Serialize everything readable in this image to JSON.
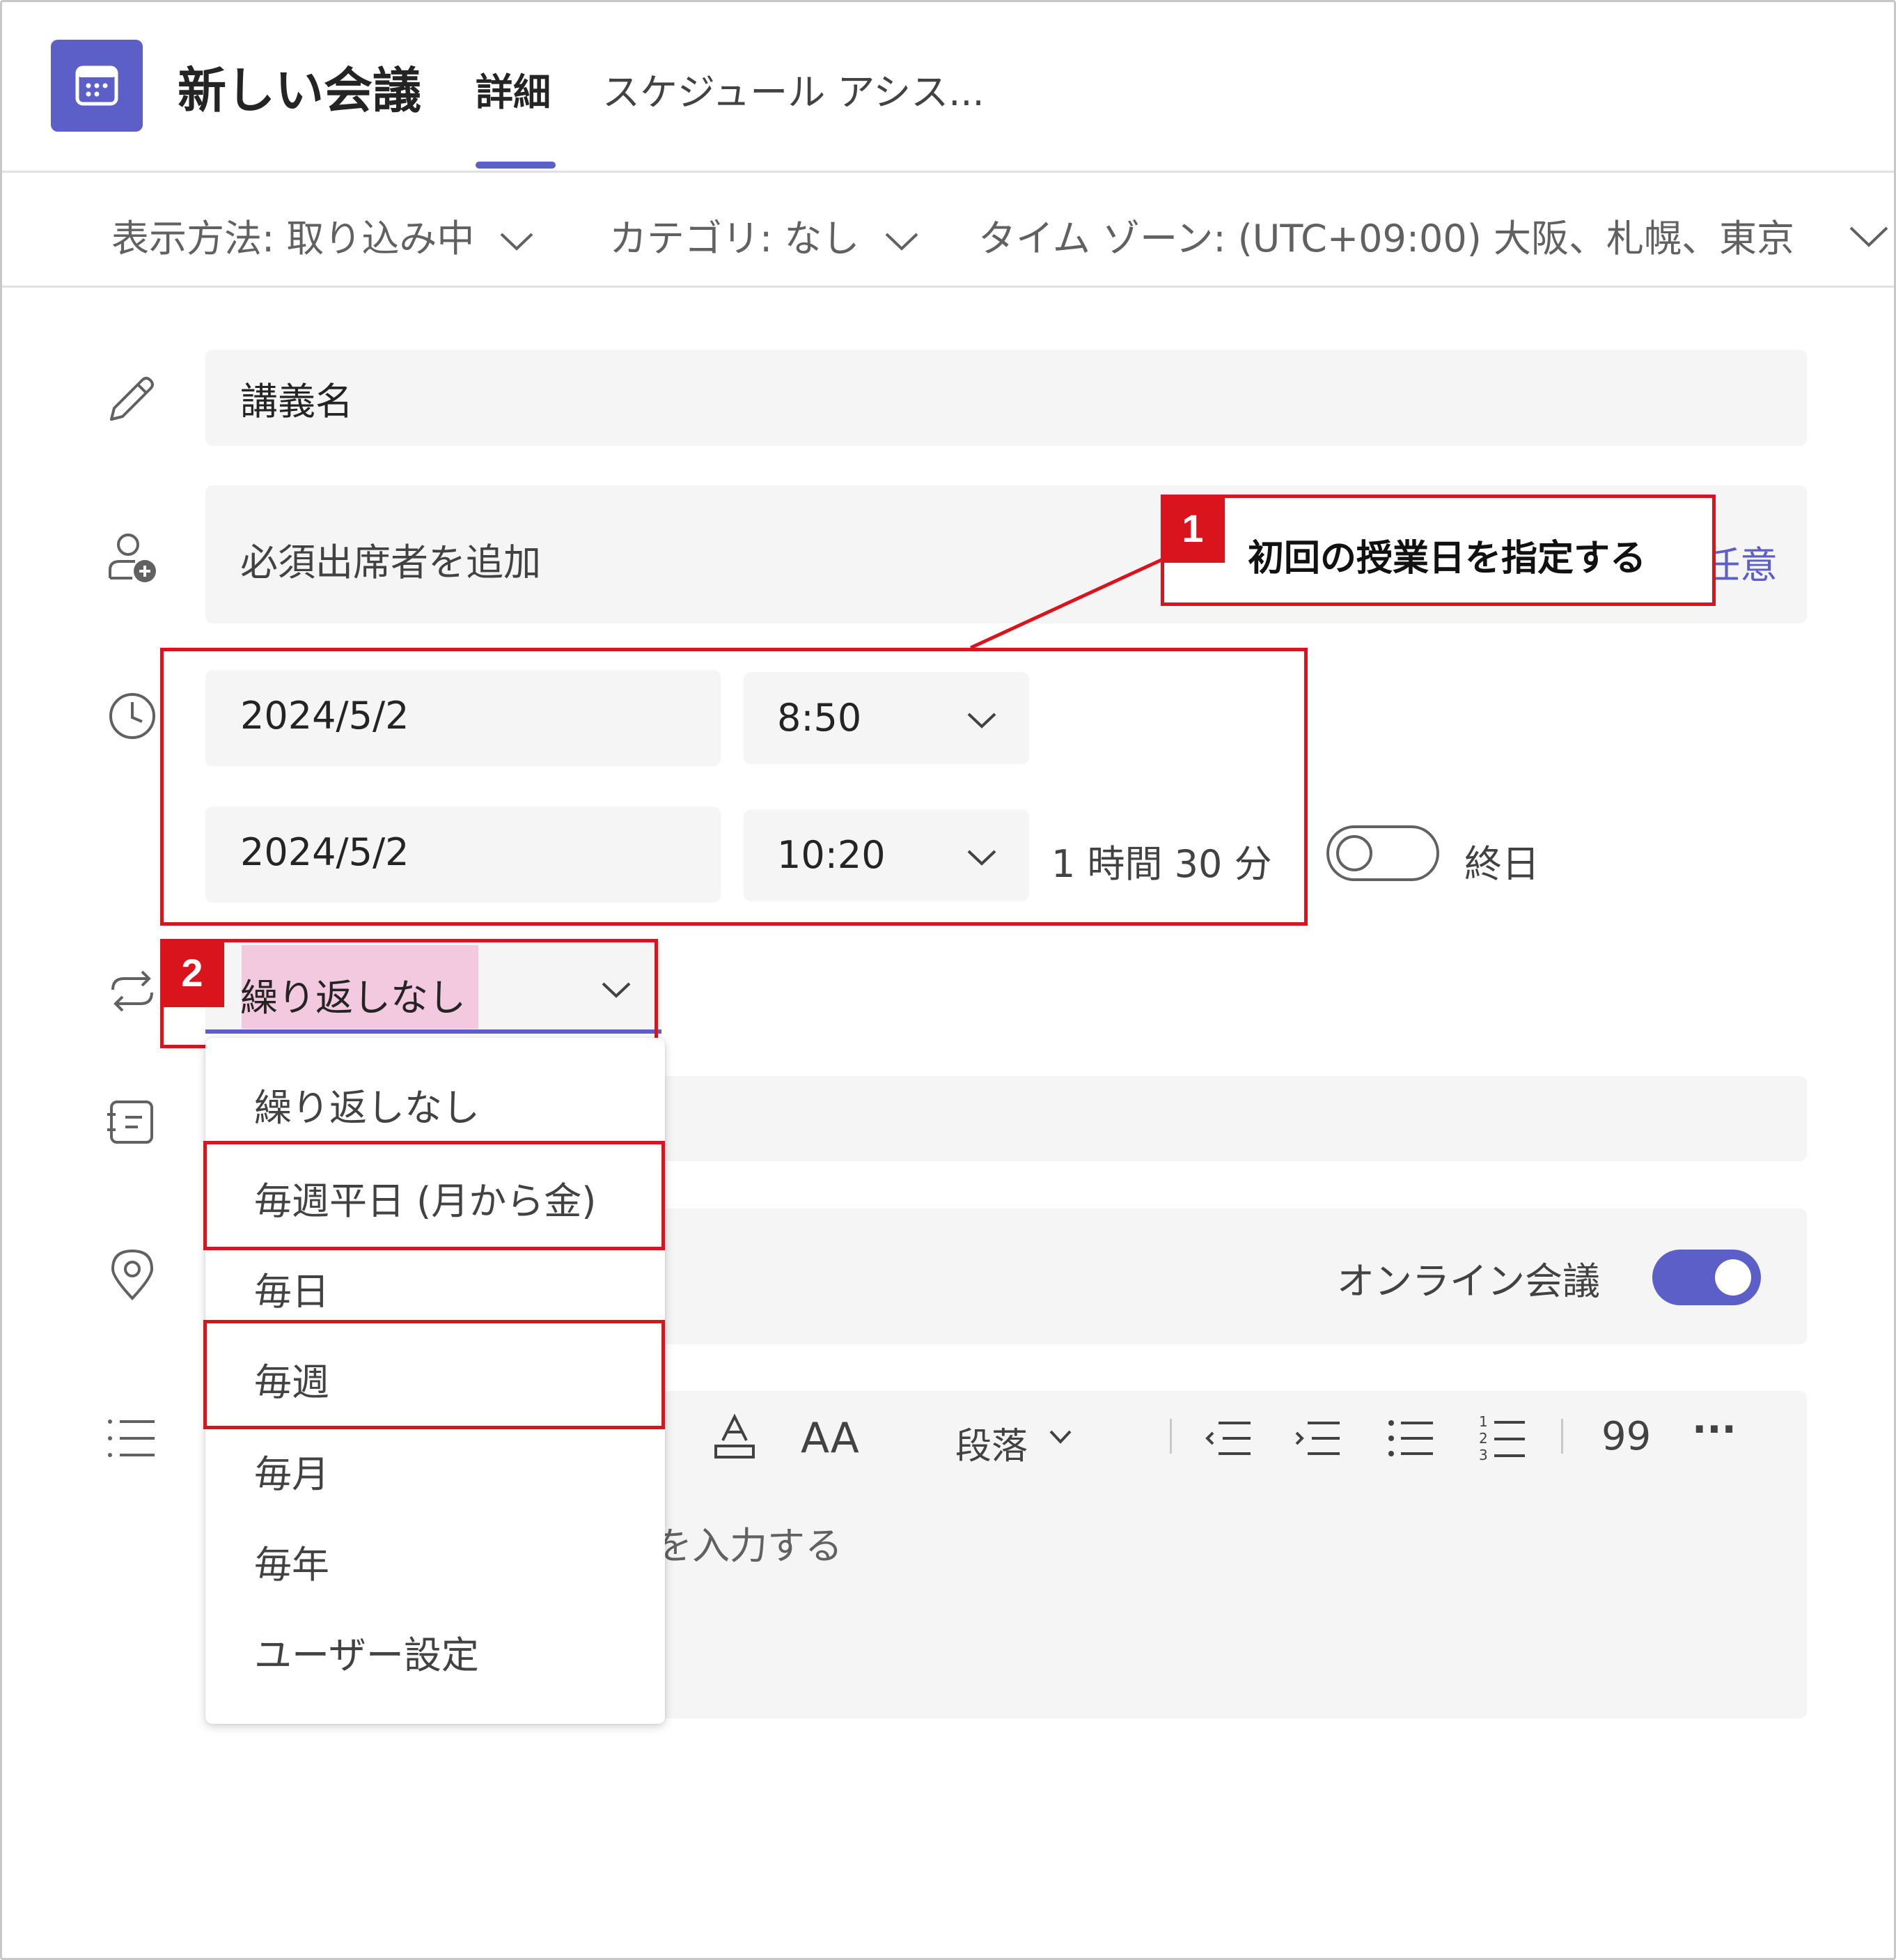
{
  "header": {
    "title": "新しい会議",
    "tabs": [
      {
        "label": "詳細",
        "active": true
      },
      {
        "label": "スケジュール アシス..."
      }
    ]
  },
  "options_bar": {
    "show_as": "表示方法: 取り込み中",
    "category": "カテゴリ: なし",
    "timezone": "タイム ゾーン: (UTC+09:00) 大阪、札幌、東京"
  },
  "form": {
    "title_value": "講義名",
    "attendees_placeholder": "必須出席者を追加",
    "optional_label": "任意",
    "start_date": "2024/5/2",
    "start_time": "8:50",
    "end_date": "2024/5/2",
    "end_time": "10:20",
    "duration": "1 時間 30 分",
    "all_day_label": "終日",
    "all_day_on": false,
    "repeat_value": "繰り返しなし",
    "online_meeting_label": "オンライン会議",
    "online_meeting_on": true,
    "body_placeholder_fragment": "を入力する"
  },
  "toolbar": {
    "paragraph_label": "段落",
    "quote_label": "99",
    "more_label": "···"
  },
  "repeat_menu": {
    "options": [
      "繰り返しなし",
      "毎週平日 (月から金)",
      "毎日",
      "毎週",
      "毎月",
      "毎年",
      "ユーザー設定"
    ]
  },
  "annotations": {
    "callout1_number": "1",
    "callout1_text": "初回の授業日を指定する",
    "callout2_number": "2"
  },
  "colors": {
    "accent": "#5b5fc7",
    "annotation_red": "#d9141c",
    "highlight_pink": "#f2c9de",
    "field_bg": "#f5f5f5"
  }
}
